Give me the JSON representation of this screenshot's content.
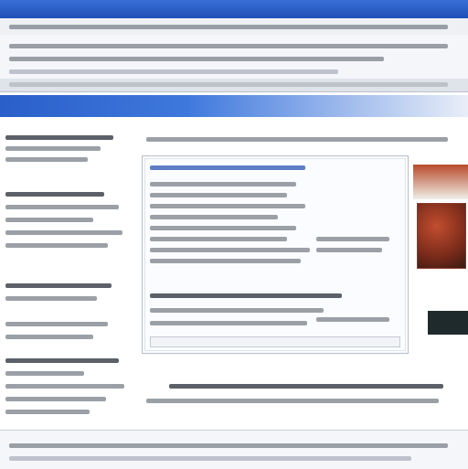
{
  "window": {
    "accent_color": "#2a5fc9",
    "background_color": "#ffffff"
  },
  "icons": {
    "menu": "menu-icon",
    "photo": "photo-icon"
  }
}
